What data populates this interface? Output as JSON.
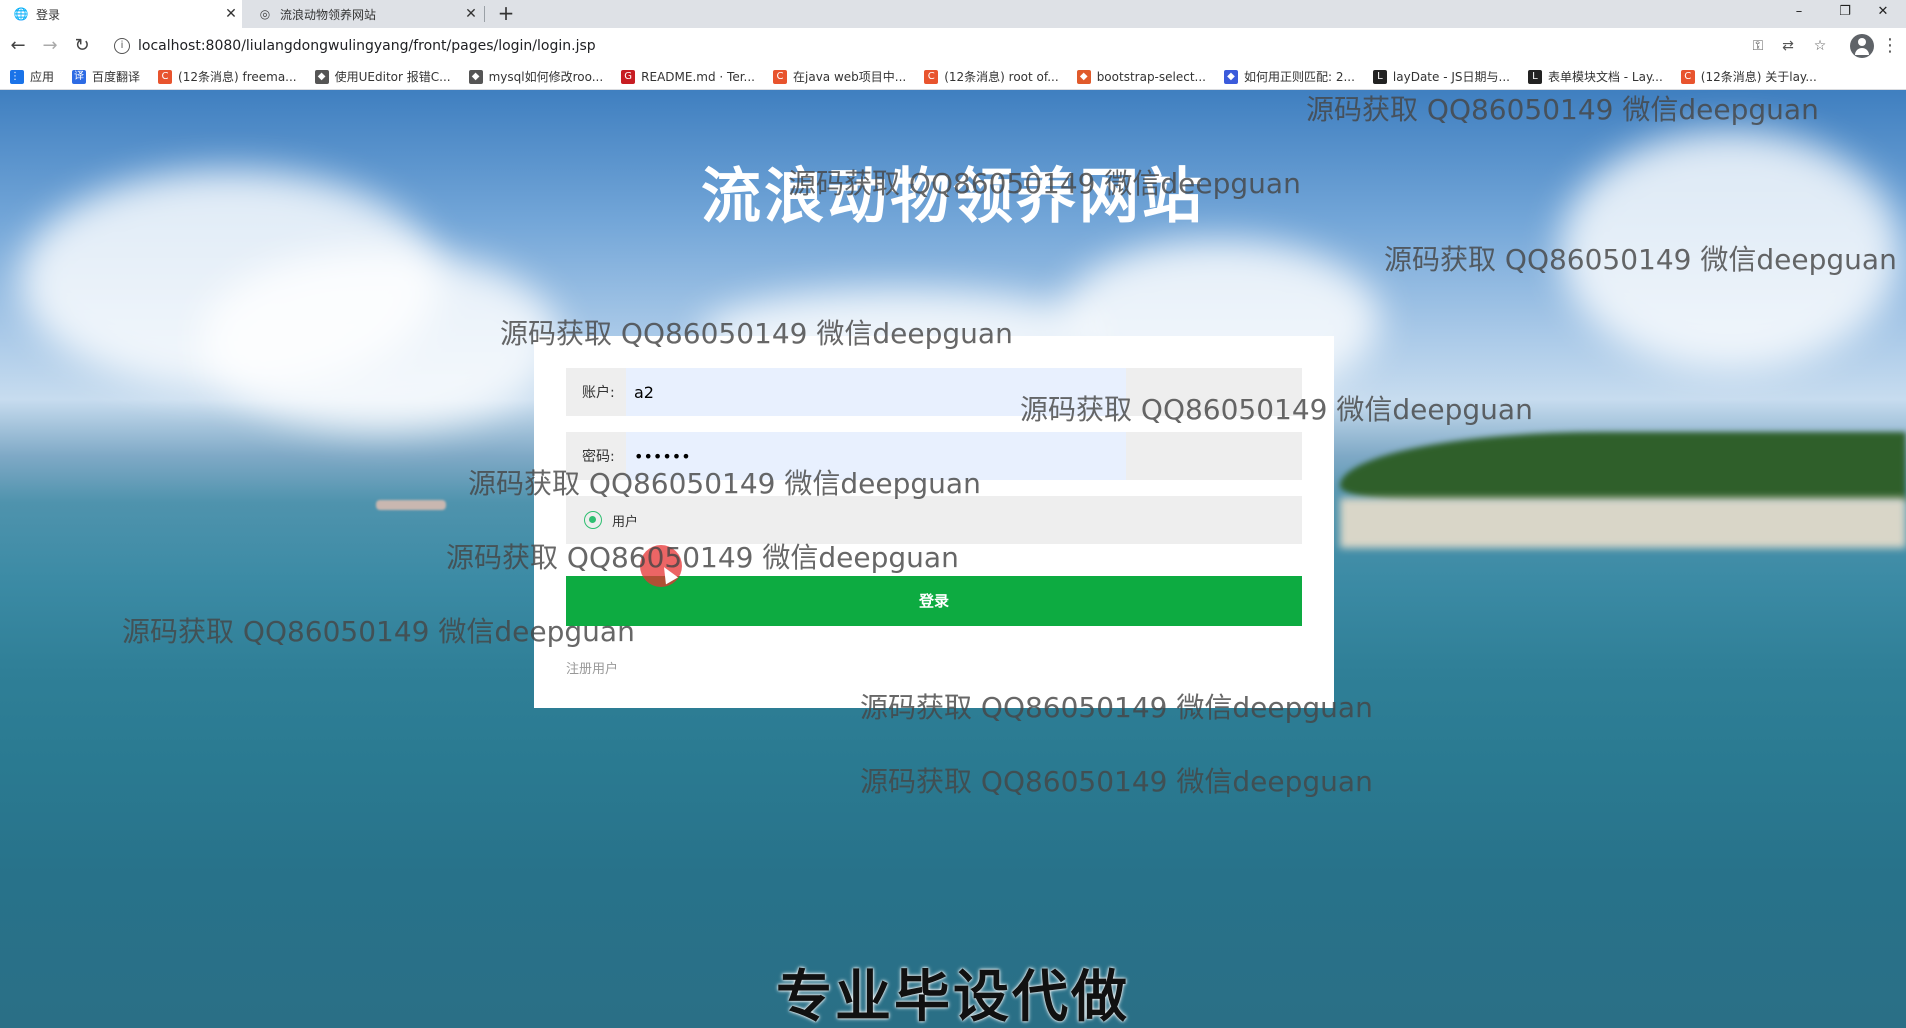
{
  "browser": {
    "tabs": [
      {
        "label": "登录",
        "icon": "globe-icon"
      },
      {
        "label": "流浪动物领养网站",
        "icon": "globe-icon"
      }
    ],
    "new_tab": "+",
    "window_controls": {
      "minimize": "–",
      "restore": "❐",
      "close": "✕"
    },
    "url": "localhost:8080/liulangdongwulingyang/front/pages/login/login.jsp",
    "bookmarks": [
      {
        "label": "应用",
        "icon": "apps-icon",
        "color": "#1a73e8"
      },
      {
        "label": "百度翻译",
        "icon": "baidu-translate-icon",
        "color": "#2d6be4"
      },
      {
        "label": "(12条消息) freema...",
        "icon": "csdn-icon",
        "color": "#e8542e"
      },
      {
        "label": "使用UEditor 报错C...",
        "icon": "bookmark-icon",
        "color": "#555555"
      },
      {
        "label": "mysql如何修改roo...",
        "icon": "bookmark-icon",
        "color": "#555555"
      },
      {
        "label": "README.md · Ter...",
        "icon": "gitee-icon",
        "color": "#c71d23"
      },
      {
        "label": "在java web项目中...",
        "icon": "csdn-icon",
        "color": "#e8542e"
      },
      {
        "label": "(12条消息) root of...",
        "icon": "csdn-icon",
        "color": "#e8542e"
      },
      {
        "label": "bootstrap-select...",
        "icon": "bookmark-icon",
        "color": "#e05a2b"
      },
      {
        "label": "如何用正则匹配: 2...",
        "icon": "bookmark-icon",
        "color": "#3b5bdb"
      },
      {
        "label": "layDate - JS日期与...",
        "icon": "layui-icon",
        "color": "#222222"
      },
      {
        "label": "表单模块文档 - Lay...",
        "icon": "layui-icon",
        "color": "#222222"
      },
      {
        "label": "(12条消息) 关于lay...",
        "icon": "csdn-icon",
        "color": "#e8542e"
      }
    ]
  },
  "page": {
    "title": "流浪动物领养网站",
    "form": {
      "account_label": "账户:",
      "account_value": "a2",
      "password_label": "密码:",
      "password_value": "••••••",
      "role_label": "用户",
      "login_button": "登录",
      "register_link": "注册用户"
    }
  },
  "overlays": {
    "watermark": "源码获取 QQ86050149 微信deepguan",
    "promo": "专业毕设代做"
  },
  "colors": {
    "login_button": "#0dab41",
    "radio_accent": "#2fbf71",
    "field_bg": "#eeeeee",
    "autofill_bg": "#e8f0fe"
  }
}
